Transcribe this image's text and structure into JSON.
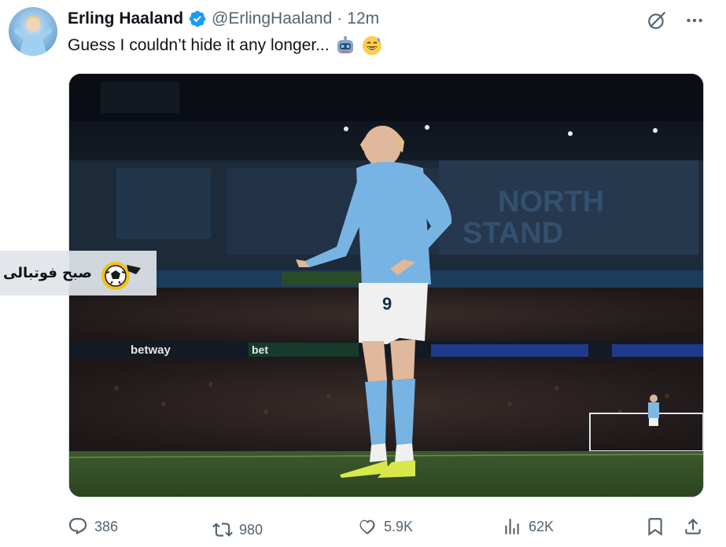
{
  "author": {
    "name": "Erling Haaland",
    "handle": "@ErlingHaaland",
    "separator": "·",
    "time": "12m"
  },
  "tweet": {
    "text": "Guess I couldn’t hide it any longer..."
  },
  "watermark": {
    "text": "صبح فوتبالی"
  },
  "image_text": {
    "sponsor_left": "betway",
    "sponsor_mid": "bet",
    "stand_line1": "NORTH",
    "stand_line2": "STAND",
    "shirt_number": "9"
  },
  "metrics": {
    "replies": "386",
    "reposts": "980",
    "likes": "5.9K",
    "views": "62K"
  },
  "icons": [
    "verified-badge-icon",
    "grok-icon",
    "more-icon",
    "robot-emoji",
    "grin-sweat-emoji",
    "reply-icon",
    "repost-icon",
    "like-icon",
    "views-icon",
    "bookmark-icon",
    "share-icon"
  ],
  "colors": {
    "verified": "#1d9bf0",
    "muted": "#536471",
    "text": "#0f1419",
    "city_blue": "#6cabdd"
  }
}
